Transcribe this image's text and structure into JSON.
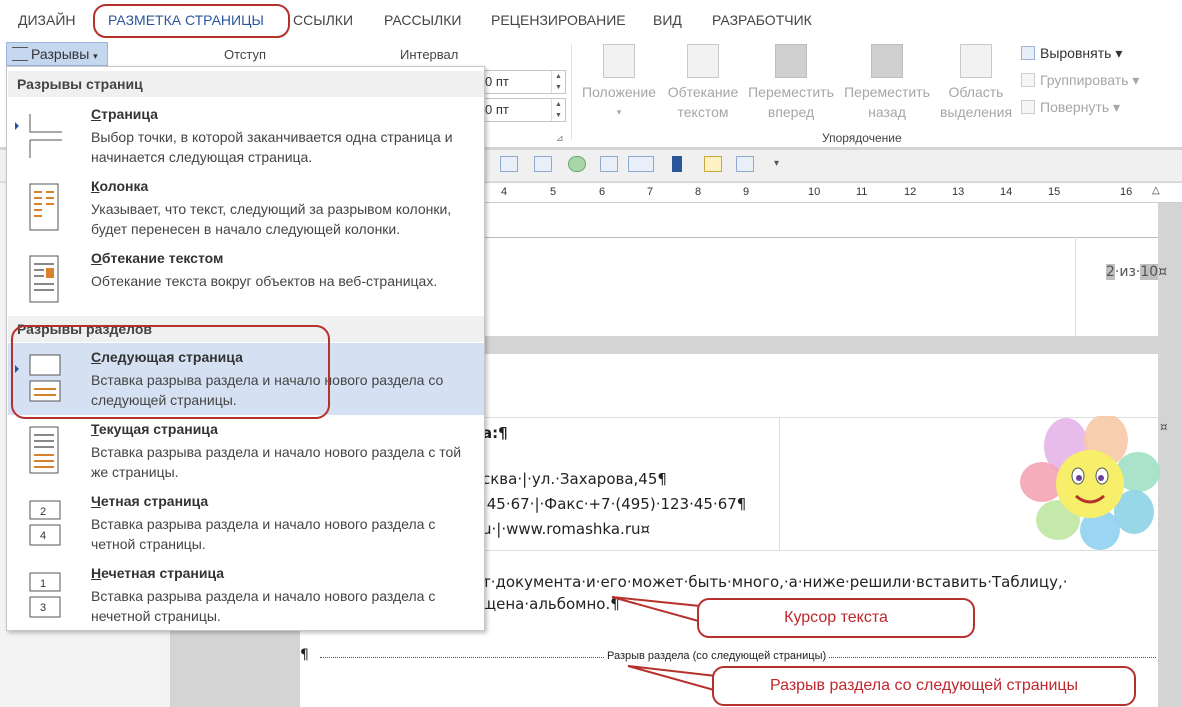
{
  "tabs": [
    "ДИЗАЙН",
    "РАЗМЕТКА СТРАНИЦЫ",
    "ССЫЛКИ",
    "РАССЫЛКИ",
    "РЕЦЕНЗИРОВАНИЕ",
    "ВИД",
    "РАЗРАБОТЧИК"
  ],
  "ribbon": {
    "breaks_button": "Разрывы",
    "indent_label": "Отступ",
    "interval_label": "Интервал",
    "interval_before": "0 пт",
    "interval_after": "0 пт",
    "position": "Положение",
    "wrap_l1": "Обтекание",
    "wrap_l2": "текстом",
    "forward_l1": "Переместить",
    "forward_l2": "вперед",
    "backward_l1": "Переместить",
    "backward_l2": "назад",
    "selection_l1": "Область",
    "selection_l2": "выделения",
    "align": "Выровнять",
    "group": "Группировать",
    "rotate": "Повернуть",
    "arrange_group": "Упорядочение"
  },
  "ruler": [
    "4",
    "5",
    "6",
    "7",
    "8",
    "9",
    "10",
    "11",
    "12",
    "13",
    "14",
    "15",
    "16"
  ],
  "menu": {
    "section1": "Разрывы страниц",
    "section2": "Разрывы разделов",
    "items": [
      {
        "title_u": "С",
        "title_rest": "траница",
        "desc": "Выбор точки, в которой заканчивается одна страница и начинается следующая страница."
      },
      {
        "title_u": "К",
        "title_rest": "олонка",
        "desc": "Указывает, что текст, следующий за разрывом колонки, будет перенесен в начало следующей колонки."
      },
      {
        "title_u": "О",
        "title_rest": "бтекание текстом",
        "desc": "Обтекание текста вокруг объектов на веб-страницах."
      },
      {
        "title_u": "С",
        "title_rest": "ледующая страница",
        "desc": "Вставка разрыва раздела и начало нового раздела со следующей страницы."
      },
      {
        "title_u": "Т",
        "title_rest": "екущая страница",
        "desc": "Вставка разрыва раздела и начало нового раздела с той же страницы."
      },
      {
        "title_u": "Ч",
        "title_rest": "етная страница",
        "desc": "Вставка разрыва раздела и начало нового раздела с четной страницы."
      },
      {
        "title_u": "Н",
        "title_rest": "ечетная страница",
        "desc": "Вставка разрыва раздела и начало нового раздела с нечетной страницы."
      }
    ]
  },
  "document": {
    "page_num_a": "2",
    "page_num_mid": "·из·",
    "page_num_b": "10",
    "page_num_mark": "¤",
    "hdr_line1": "а:¶",
    "hdr_line2": "сква·|·ул.·Захарова,45¶",
    "hdr_line3": "·45·67·|·Факс·+7·(495)·123·45·67¶",
    "hdr_line4": "u·|·www.romashka.ru¤",
    "cell_mark": "¤",
    "body_line1": "т·документа·и·его·может·быть·много,·а·ниже·решили·вставить·Таблицу,·",
    "body_line2": "щена·альбомно.¶",
    "pilcrow": "¶",
    "section_break": "Разрыв раздела (со следующей страницы)"
  },
  "callouts": {
    "cursor": "Курсор текста",
    "section_break": "Разрыв раздела со следующей страницы"
  },
  "colors": {
    "accent": "#2b579a",
    "annotation": "#b5312c",
    "selected_item": "#d5e1f2"
  }
}
